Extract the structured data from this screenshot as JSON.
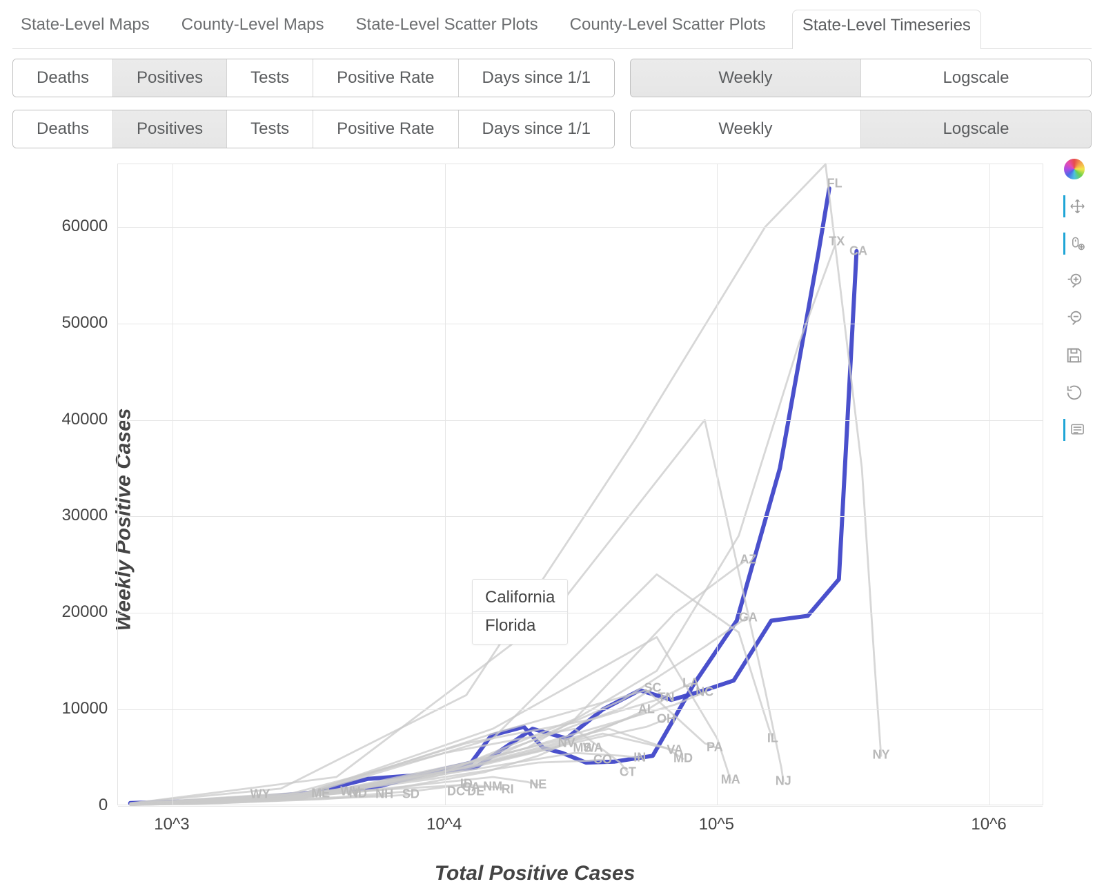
{
  "tabs": [
    "State-Level Maps",
    "County-Level Maps",
    "State-Level Scatter Plots",
    "County-Level Scatter Plots",
    "State-Level Timeseries"
  ],
  "tabs_active_index": 4,
  "bar1_group1": [
    "Deaths",
    "Positives",
    "Tests",
    "Positive Rate",
    "Days since 1/1"
  ],
  "bar1_group1_selected": 1,
  "bar1_group2": [
    "Weekly",
    "Logscale"
  ],
  "bar1_group2_selected": 0,
  "bar2_group1": [
    "Deaths",
    "Positives",
    "Tests",
    "Positive Rate",
    "Days since 1/1"
  ],
  "bar2_group1_selected": 1,
  "bar2_group2": [
    "Weekly",
    "Logscale"
  ],
  "bar2_group2_selected": 1,
  "ylabel": "Weekly Positive Cases",
  "xlabel": "Total Positive Cases",
  "yticks": [
    0,
    10000,
    20000,
    30000,
    40000,
    50000,
    60000
  ],
  "xticks": [
    "10^3",
    "10^4",
    "10^5",
    "10^6"
  ],
  "tooltip": {
    "items": [
      "California",
      "Florida"
    ]
  },
  "tools": [
    "bokeh-logo",
    "pan",
    "wheel-pan",
    "zoom-in",
    "zoom-out",
    "save",
    "reset",
    "hover"
  ],
  "state_labels": [
    {
      "t": "FL",
      "xu": 270000,
      "yv": 64500
    },
    {
      "t": "TX",
      "xu": 275000,
      "yv": 58500
    },
    {
      "t": "CA",
      "xu": 330000,
      "yv": 57500
    },
    {
      "t": "AZ",
      "xu": 130000,
      "yv": 25500
    },
    {
      "t": "GA",
      "xu": 130000,
      "yv": 19500
    },
    {
      "t": "LA",
      "xu": 80000,
      "yv": 12700,
      "inline": true
    },
    {
      "t": "SC",
      "xu": 58000,
      "yv": 12200
    },
    {
      "t": "NC",
      "xu": 90000,
      "yv": 11800
    },
    {
      "t": "TN",
      "xu": 65000,
      "yv": 11200,
      "inline": true
    },
    {
      "t": "AL",
      "xu": 55000,
      "yv": 10000
    },
    {
      "t": "OH",
      "xu": 65000,
      "yv": 9000
    },
    {
      "t": "NV",
      "xu": 28000,
      "yv": 6500
    },
    {
      "t": "MS",
      "xu": 32000,
      "yv": 6000,
      "inline": true
    },
    {
      "t": "WA",
      "xu": 35000,
      "yv": 6000,
      "inline": true
    },
    {
      "t": "VA",
      "xu": 70000,
      "yv": 5800
    },
    {
      "t": "PA",
      "xu": 98000,
      "yv": 6100
    },
    {
      "t": "IL",
      "xu": 160000,
      "yv": 7000
    },
    {
      "t": "NY",
      "xu": 400000,
      "yv": 5300
    },
    {
      "t": "CO",
      "xu": 38000,
      "yv": 4800
    },
    {
      "t": "IN",
      "xu": 52000,
      "yv": 5000,
      "inline": true
    },
    {
      "t": "MD",
      "xu": 75000,
      "yv": 4900
    },
    {
      "t": "CT",
      "xu": 47000,
      "yv": 3500
    },
    {
      "t": "MA",
      "xu": 112000,
      "yv": 2700
    },
    {
      "t": "NJ",
      "xu": 175000,
      "yv": 2600
    },
    {
      "t": "NE",
      "xu": 22000,
      "yv": 2200
    },
    {
      "t": "RI",
      "xu": 17000,
      "yv": 1700
    },
    {
      "t": "CA_",
      "xu": 12500,
      "yv": 1900,
      "t_": "CA",
      "inline": true
    },
    {
      "t": "NM",
      "xu": 15000,
      "yv": 2000,
      "inline": true
    },
    {
      "t": "DE",
      "xu": 13000,
      "yv": 1500,
      "inline": true
    },
    {
      "t": "DC",
      "xu": 11000,
      "yv": 1500
    },
    {
      "t": "ID",
      "xu": 12000,
      "yv": 2300
    },
    {
      "t": "NH",
      "xu": 6000,
      "yv": 1200
    },
    {
      "t": "SD",
      "xu": 7500,
      "yv": 1200
    },
    {
      "t": "ND",
      "xu": 4800,
      "yv": 1300,
      "inline": true
    },
    {
      "t": "ME",
      "xu": 3500,
      "yv": 1300
    },
    {
      "t": "WV",
      "xu": 4500,
      "yv": 1500
    },
    {
      "t": "WY",
      "xu": 2100,
      "yv": 1200
    }
  ],
  "chart_data": {
    "type": "line",
    "xlabel": "Total Positive Cases",
    "ylabel": "Weekly Positive Cases",
    "x_scale": "log",
    "y_scale": "linear",
    "xlim_log10": [
      2.8,
      6.2
    ],
    "ylim": [
      0,
      66500
    ],
    "xticks_log10": [
      3,
      4,
      5,
      6
    ],
    "yticks": [
      0,
      10000,
      20000,
      30000,
      40000,
      50000,
      60000
    ],
    "highlighted": [
      "California",
      "Florida"
    ],
    "series": [
      {
        "name": "California",
        "color": "#4047c9",
        "x": [
          700,
          1200,
          2100,
          3600,
          5500,
          9000,
          13000,
          21000,
          28000,
          38000,
          52000,
          68000,
          90000,
          115000,
          158000,
          215000,
          280000,
          325000
        ],
        "y": [
          300,
          500,
          900,
          1500,
          1900,
          3500,
          4000,
          8000,
          7000,
          10000,
          12000,
          11000,
          12000,
          13000,
          19200,
          19700,
          23500,
          57500
        ]
      },
      {
        "name": "Florida",
        "color": "#4047c9",
        "x": [
          700,
          1100,
          1900,
          3200,
          5200,
          8000,
          12500,
          14800,
          19500,
          23000,
          27000,
          33000,
          42000,
          58000,
          82000,
          118000,
          170000,
          235000,
          258000
        ],
        "y": [
          280,
          400,
          800,
          1300,
          2800,
          3200,
          4500,
          7300,
          8200,
          6000,
          5500,
          4500,
          4600,
          5200,
          12600,
          19200,
          35000,
          57200,
          64000
        ]
      },
      {
        "name": "New York",
        "approx": true,
        "x": [
          700,
          2500,
          12000,
          50000,
          150000,
          250000,
          340000,
          380000,
          398000,
          400000
        ],
        "y": [
          300,
          1800,
          11500,
          38000,
          60000,
          66500,
          35000,
          14000,
          6000,
          5200
        ]
      },
      {
        "name": "Texas",
        "approx": true,
        "x": [
          700,
          5000,
          20000,
          60000,
          120000,
          200000,
          270000
        ],
        "y": [
          250,
          1800,
          6000,
          14000,
          28000,
          48000,
          58000
        ]
      },
      {
        "name": "Arizona",
        "approx": true,
        "x": [
          700,
          3000,
          10000,
          30000,
          70000,
          128000
        ],
        "y": [
          200,
          1000,
          3500,
          9000,
          20000,
          25500
        ]
      },
      {
        "name": "Georgia",
        "approx": true,
        "x": [
          700,
          4000,
          15000,
          45000,
          90000,
          128000
        ],
        "y": [
          250,
          1500,
          5000,
          11000,
          16500,
          19500
        ]
      },
      {
        "name": "New Jersey",
        "approx": true,
        "x": [
          700,
          4000,
          25000,
          90000,
          150000,
          172000,
          175000
        ],
        "y": [
          250,
          3000,
          20000,
          40000,
          12000,
          4000,
          2600
        ]
      },
      {
        "name": "Illinois",
        "approx": true,
        "x": [
          700,
          3000,
          15000,
          60000,
          120000,
          155000,
          160000
        ],
        "y": [
          200,
          1100,
          7000,
          24000,
          18000,
          8000,
          7000
        ]
      },
      {
        "name": "Massachusetts",
        "approx": true,
        "x": [
          700,
          3000,
          15000,
          60000,
          100000,
          112000
        ],
        "y": [
          200,
          1200,
          8000,
          17500,
          7000,
          2700
        ]
      },
      {
        "name": "Pennsylvania",
        "approx": true,
        "x": [
          700,
          3000,
          15000,
          55000,
          90000,
          98000
        ],
        "y": [
          200,
          1100,
          7500,
          12000,
          6500,
          6100
        ]
      },
      {
        "name": "Louisiana",
        "approx": true,
        "x": [
          700,
          3000,
          12000,
          35000,
          60000,
          80000
        ],
        "y": [
          250,
          1300,
          6500,
          9000,
          11000,
          12700
        ]
      },
      {
        "name": "North Carolina",
        "approx": true,
        "x": [
          700,
          3000,
          12000,
          40000,
          70000,
          90000
        ],
        "y": [
          200,
          900,
          4200,
          8500,
          10500,
          11800
        ]
      },
      {
        "name": "South Carolina",
        "approx": true,
        "x": [
          700,
          2500,
          9000,
          25000,
          45000,
          58000
        ],
        "y": [
          180,
          800,
          3200,
          7500,
          10200,
          12200
        ]
      },
      {
        "name": "Tennessee",
        "approx": true,
        "x": [
          700,
          2500,
          10000,
          30000,
          52000,
          65000
        ],
        "y": [
          180,
          800,
          3500,
          7000,
          9500,
          11200
        ]
      },
      {
        "name": "Alabama",
        "approx": true,
        "x": [
          700,
          2500,
          9000,
          25000,
          42000,
          55000
        ],
        "y": [
          180,
          700,
          3000,
          6000,
          8500,
          10000
        ]
      },
      {
        "name": "Ohio",
        "approx": true,
        "x": [
          700,
          3000,
          12000,
          35000,
          55000,
          65000
        ],
        "y": [
          200,
          900,
          4000,
          7000,
          8200,
          9000
        ]
      },
      {
        "name": "Maryland",
        "approx": true,
        "x": [
          700,
          3000,
          12000,
          40000,
          65000,
          75000
        ],
        "y": [
          180,
          900,
          4500,
          8000,
          6000,
          4900
        ]
      },
      {
        "name": "Virginia",
        "approx": true,
        "x": [
          700,
          3000,
          12000,
          38000,
          60000,
          70000
        ],
        "y": [
          180,
          800,
          4000,
          7500,
          6200,
          5800
        ]
      },
      {
        "name": "Indiana",
        "approx": true,
        "x": [
          700,
          3000,
          11000,
          30000,
          45000,
          52000
        ],
        "y": [
          170,
          800,
          3500,
          5500,
          5200,
          5000
        ]
      },
      {
        "name": "Connecticut",
        "approx": true,
        "x": [
          700,
          2500,
          10000,
          30000,
          44000,
          47000
        ],
        "y": [
          170,
          1000,
          5500,
          8000,
          4500,
          3500
        ]
      },
      {
        "name": "Colorado",
        "approx": true,
        "x": [
          700,
          2500,
          9000,
          22000,
          34000,
          38000
        ],
        "y": [
          170,
          700,
          2800,
          4500,
          4700,
          4800
        ]
      },
      {
        "name": "Nevada",
        "approx": true,
        "x": [
          700,
          2000,
          6500,
          14000,
          22000,
          28000
        ],
        "y": [
          150,
          500,
          1800,
          3500,
          5200,
          6500
        ]
      },
      {
        "name": "Nebraska",
        "approx": true,
        "x": [
          700,
          2000,
          7000,
          15000,
          20000,
          22000
        ],
        "y": [
          150,
          500,
          2000,
          3000,
          2500,
          2200
        ]
      },
      {
        "name": "Rhode Island",
        "approx": true,
        "x": [
          700,
          1800,
          6000,
          12000,
          16000,
          17000
        ],
        "y": [
          140,
          450,
          1700,
          2200,
          1900,
          1700
        ]
      },
      {
        "name": "Idaho",
        "approx": true,
        "x": [
          700,
          1500,
          4000,
          8000,
          11000,
          12000
        ],
        "y": [
          130,
          350,
          900,
          1600,
          2100,
          2300
        ]
      },
      {
        "name": "New Hampshire",
        "approx": true,
        "x": [
          700,
          1500,
          3500,
          5200,
          5800,
          6000
        ],
        "y": [
          120,
          300,
          700,
          1000,
          1100,
          1200
        ]
      },
      {
        "name": "South Dakota",
        "approx": true,
        "x": [
          700,
          1500,
          3800,
          6000,
          7200,
          7500
        ],
        "y": [
          120,
          300,
          800,
          1000,
          1150,
          1200
        ]
      },
      {
        "name": "Maine",
        "approx": true,
        "x": [
          700,
          1200,
          2200,
          3000,
          3400,
          3500
        ],
        "y": [
          110,
          250,
          600,
          900,
          1200,
          1300
        ]
      },
      {
        "name": "Wyoming",
        "approx": true,
        "x": [
          700,
          1000,
          1500,
          1900,
          2050,
          2100
        ],
        "y": [
          100,
          200,
          450,
          800,
          1050,
          1200
        ]
      }
    ]
  }
}
